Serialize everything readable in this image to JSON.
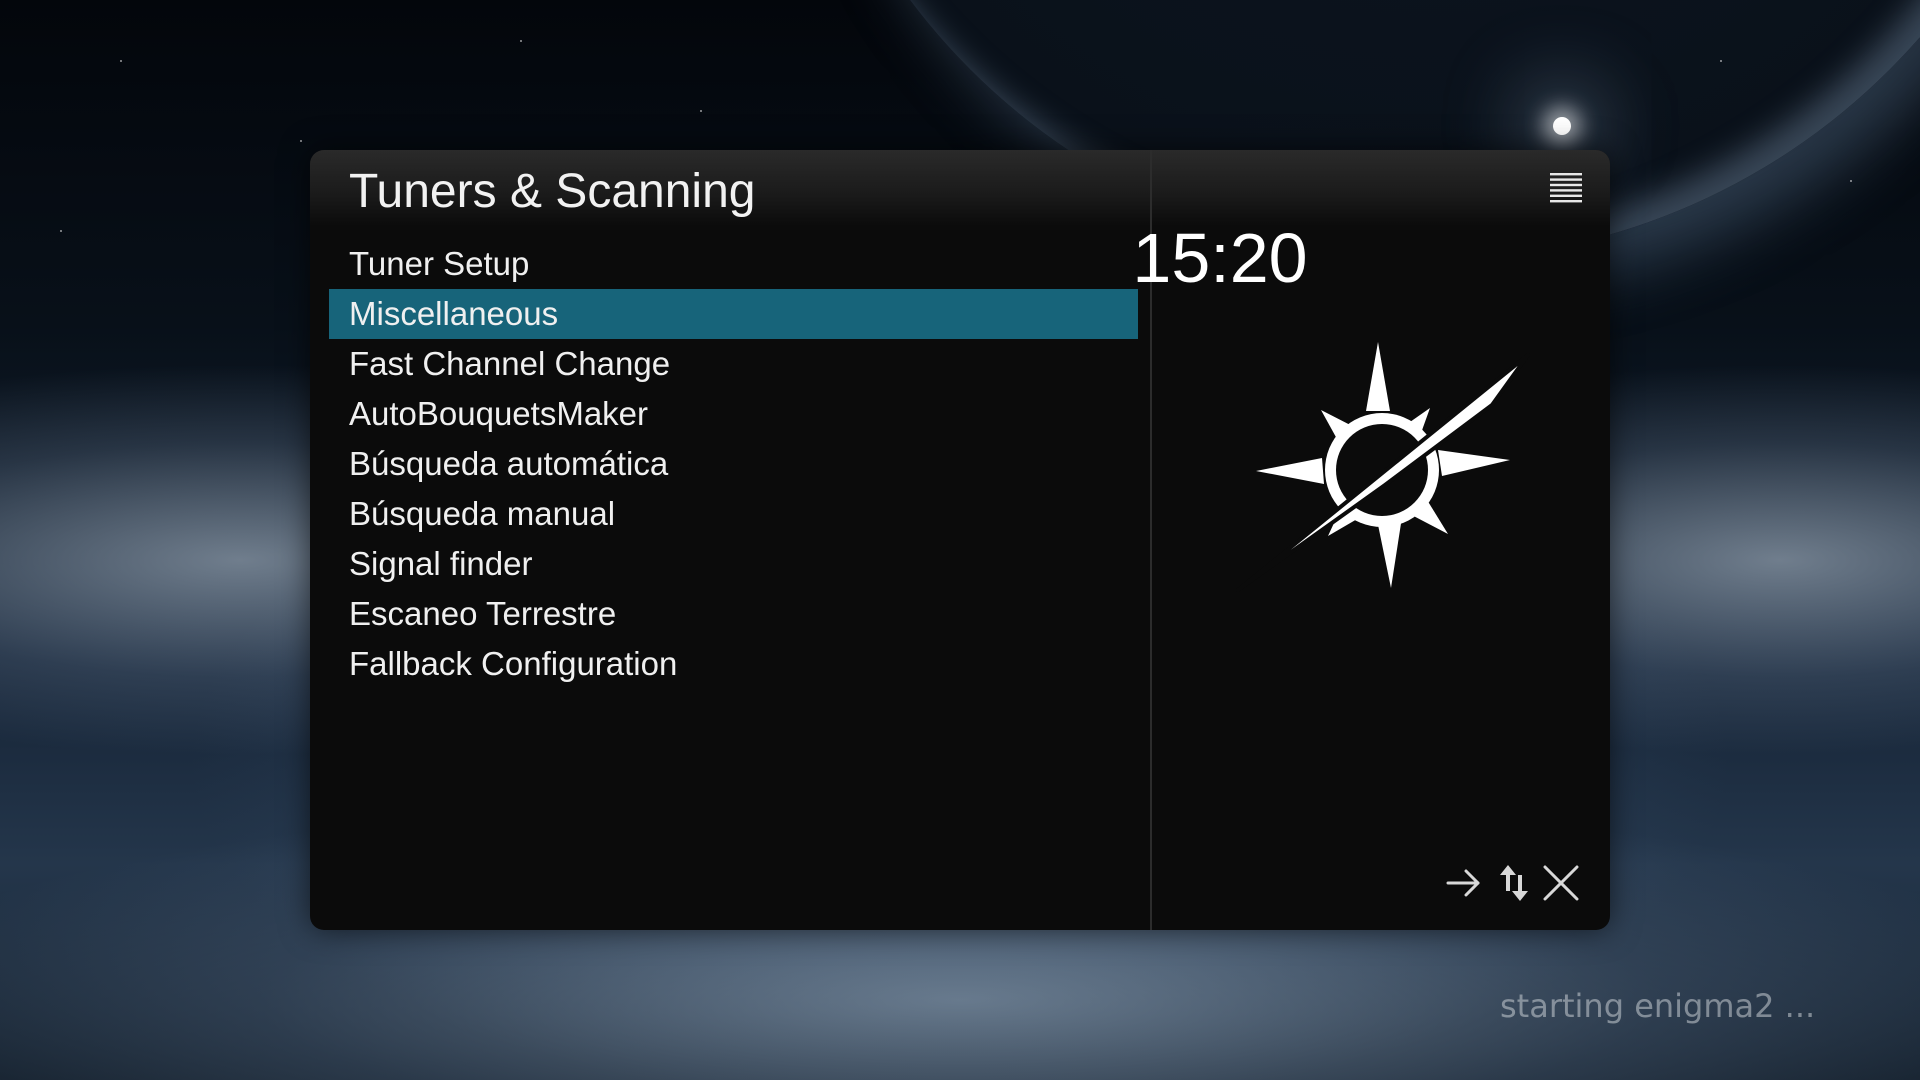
{
  "screen": {
    "title": "Tuners & Scanning",
    "menu_items": [
      {
        "label": "Tuner Setup",
        "selected": false
      },
      {
        "label": "Miscellaneous",
        "selected": true
      },
      {
        "label": "Fast Channel Change",
        "selected": false
      },
      {
        "label": "AutoBouquetsMaker",
        "selected": false
      },
      {
        "label": "Búsqueda automática",
        "selected": false
      },
      {
        "label": "Búsqueda manual",
        "selected": false
      },
      {
        "label": "Signal finder",
        "selected": false
      },
      {
        "label": "Escaneo Terrestre",
        "selected": false
      },
      {
        "label": "Fallback Configuration",
        "selected": false
      }
    ],
    "selected_color": "#17647a"
  },
  "side_panel": {
    "clock": "15:20",
    "menu_icon": "menu-lines-icon",
    "graphic": "compass-icon"
  },
  "footer_icons": [
    "arrow-right-icon",
    "up-down-arrows-icon",
    "close-icon"
  ],
  "status": {
    "text": "starting enigma2 ..."
  }
}
